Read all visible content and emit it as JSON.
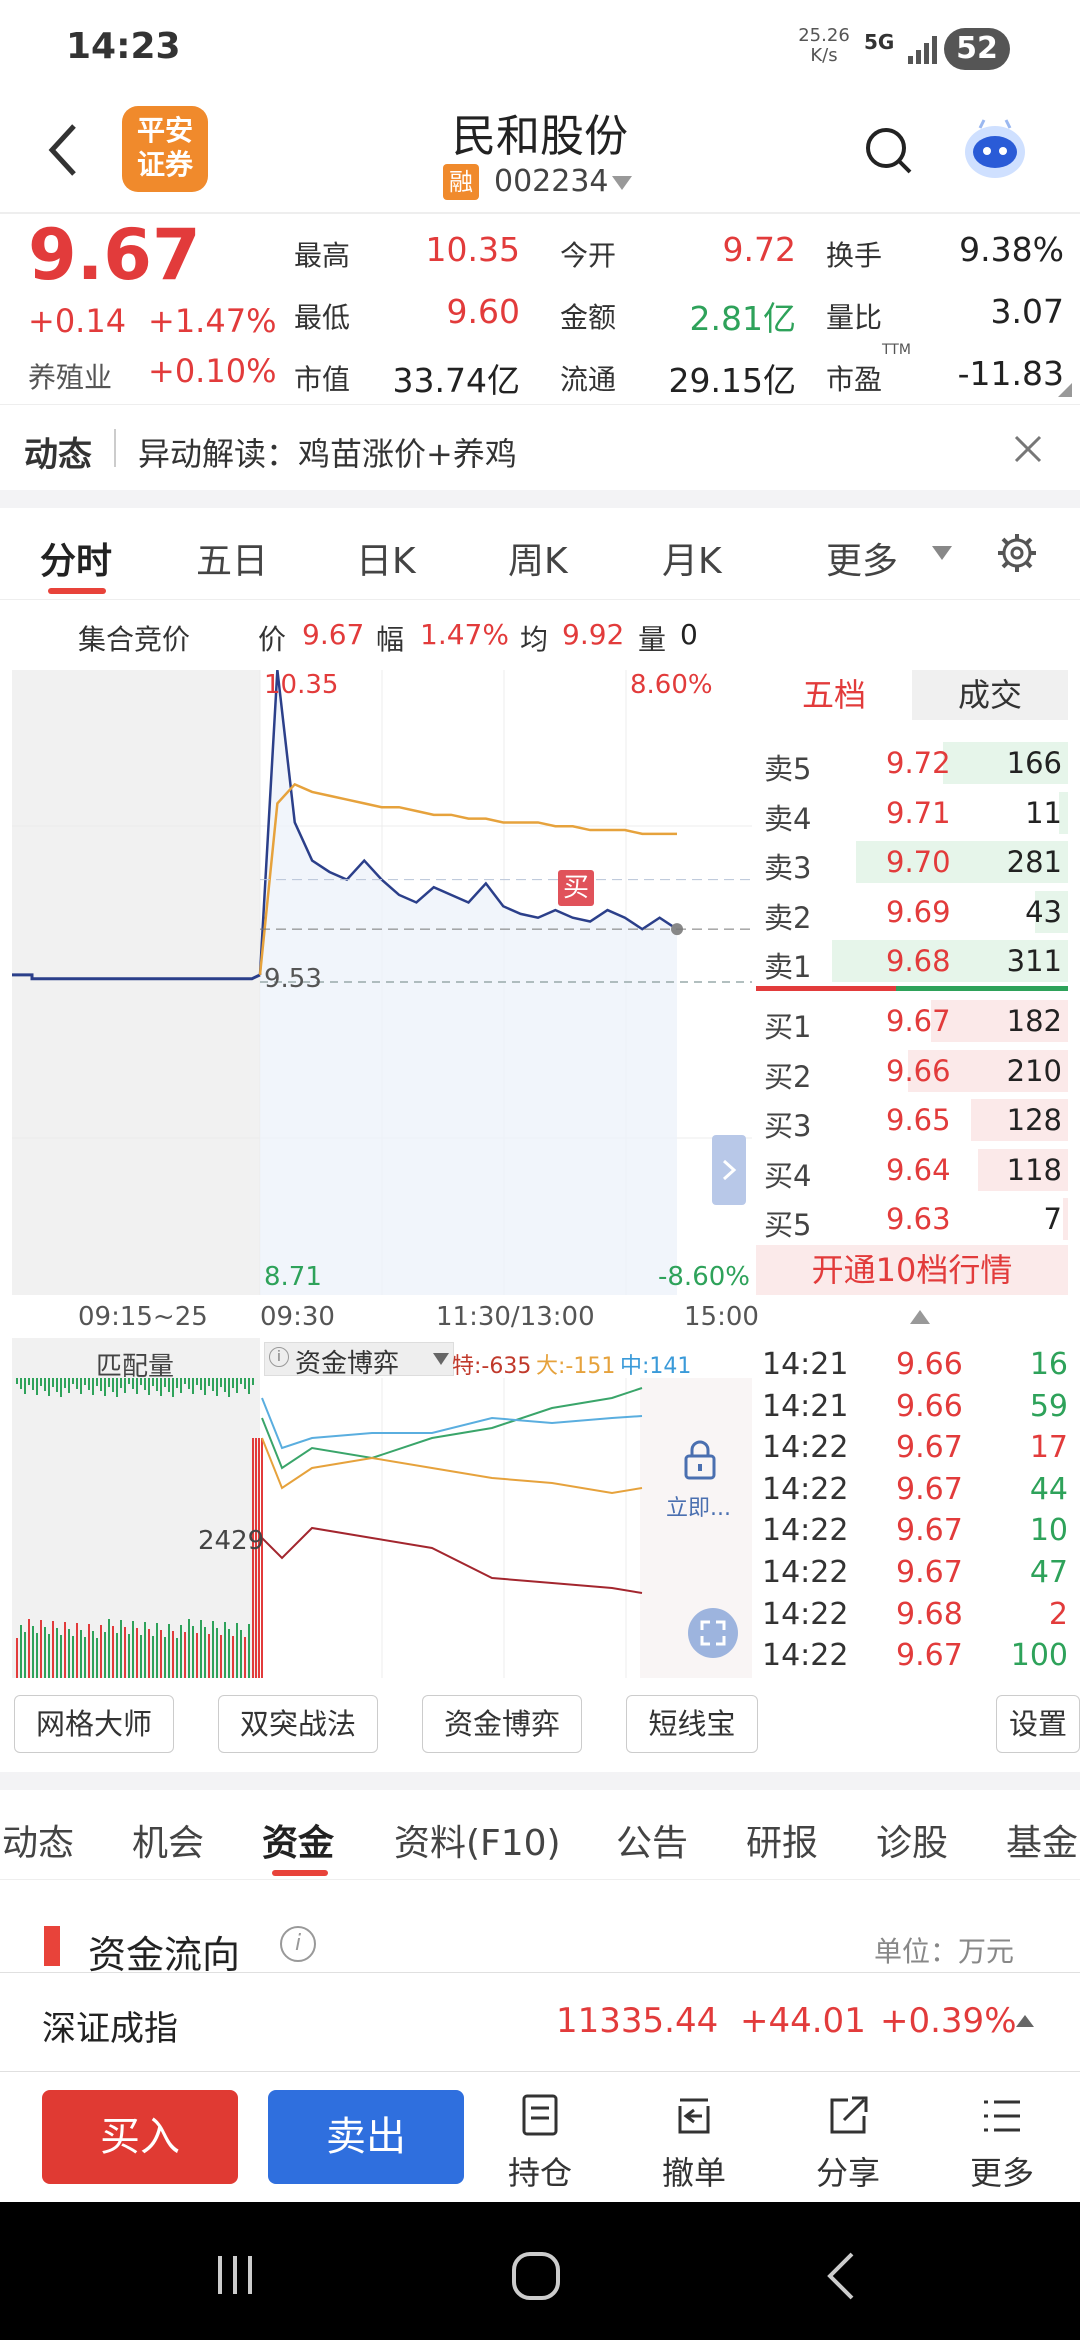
{
  "status": {
    "time": "14:23",
    "speed": "25.26",
    "speed_unit": "K/s",
    "network": "5G",
    "battery": "52"
  },
  "header": {
    "logo_line1": "平安",
    "logo_line2": "证券",
    "title": "民和股份",
    "badge": "融",
    "code": "002234"
  },
  "quote": {
    "price": "9.67",
    "change": "+0.14",
    "change_pct": "+1.47%",
    "industry": "养殖业",
    "industry_pct": "+0.10%",
    "stats": [
      {
        "label": "最高",
        "value": "10.35"
      },
      {
        "label": "今开",
        "value": "9.72"
      },
      {
        "label": "换手",
        "value": "9.38%"
      },
      {
        "label": "最低",
        "value": "9.60"
      },
      {
        "label": "金额",
        "value": "2.81亿"
      },
      {
        "label": "量比",
        "value": "3.07"
      },
      {
        "label": "市值",
        "value": "33.74亿"
      },
      {
        "label": "流通",
        "value": "29.15亿"
      },
      {
        "label": "市盈",
        "value": "-11.83"
      }
    ],
    "ttm": "TTM"
  },
  "news": {
    "label": "动态",
    "text": "异动解读：鸡苗涨价+养鸡"
  },
  "chart_tabs": [
    "分时",
    "五日",
    "日K",
    "周K",
    "月K",
    "更多"
  ],
  "chart_info": {
    "auction": "集合竞价",
    "price_label": "价",
    "price": "9.67",
    "amp_label": "幅",
    "amp": "1.47%",
    "avg_label": "均",
    "avg": "9.92",
    "vol_label": "量",
    "vol": "0"
  },
  "chart_data": {
    "type": "line",
    "y_high": "10.35",
    "y_low": "8.71",
    "y_mid": "9.53",
    "pct_high": "8.60%",
    "pct_low": "-8.60%",
    "x_ticks": [
      "09:15~25",
      "09:30",
      "11:30/13:00",
      "15:00"
    ],
    "ylim": [
      8.71,
      10.35
    ],
    "series": [
      {
        "name": "价",
        "color": "#2b3f8a",
        "values": [
          9.55,
          10.35,
          9.95,
          9.85,
          9.82,
          9.8,
          9.85,
          9.8,
          9.76,
          9.74,
          9.78,
          9.76,
          9.74,
          9.79,
          9.73,
          9.71,
          9.7,
          9.72,
          9.7,
          9.69,
          9.72,
          9.7,
          9.67,
          9.7,
          9.67
        ]
      },
      {
        "name": "均",
        "color": "#e6a23c",
        "values": [
          9.55,
          10.0,
          10.05,
          10.03,
          10.02,
          10.01,
          10.0,
          9.99,
          9.99,
          9.98,
          9.97,
          9.97,
          9.96,
          9.96,
          9.95,
          9.95,
          9.95,
          9.94,
          9.94,
          9.93,
          9.93,
          9.93,
          9.92,
          9.92,
          9.92
        ]
      }
    ],
    "buy_marker": "买"
  },
  "order_book": {
    "tab_active": "五档",
    "tab_other": "成交",
    "asks": [
      {
        "label": "卖5",
        "price": "9.72",
        "vol": "166",
        "ratio": 0.53
      },
      {
        "label": "卖4",
        "price": "9.71",
        "vol": "11",
        "ratio": 0.04
      },
      {
        "label": "卖3",
        "price": "9.70",
        "vol": "281",
        "ratio": 0.9
      },
      {
        "label": "卖2",
        "price": "9.69",
        "vol": "43",
        "ratio": 0.14
      },
      {
        "label": "卖1",
        "price": "9.68",
        "vol": "311",
        "ratio": 1.0
      }
    ],
    "bids": [
      {
        "label": "买1",
        "price": "9.67",
        "vol": "182",
        "ratio": 0.58
      },
      {
        "label": "买2",
        "price": "9.66",
        "vol": "210",
        "ratio": 0.68
      },
      {
        "label": "买3",
        "price": "9.65",
        "vol": "128",
        "ratio": 0.41
      },
      {
        "label": "买4",
        "price": "9.64",
        "vol": "118",
        "ratio": 0.38
      },
      {
        "label": "买5",
        "price": "9.63",
        "vol": "7",
        "ratio": 0.02
      }
    ],
    "upgrade": "开通10档行情"
  },
  "flow": {
    "match_label": "匹配量",
    "mode": "资金博弈",
    "special": "特:-635",
    "large": "大:-151",
    "mid": "中:141",
    "vol_value": "2429",
    "lock_text": "立即..."
  },
  "ticks": [
    {
      "time": "14:21",
      "price": "9.66",
      "vol": "16",
      "dir": "green"
    },
    {
      "time": "14:21",
      "price": "9.66",
      "vol": "59",
      "dir": "green"
    },
    {
      "time": "14:22",
      "price": "9.67",
      "vol": "17",
      "dir": "red"
    },
    {
      "time": "14:22",
      "price": "9.67",
      "vol": "44",
      "dir": "green"
    },
    {
      "time": "14:22",
      "price": "9.67",
      "vol": "10",
      "dir": "green"
    },
    {
      "time": "14:22",
      "price": "9.67",
      "vol": "47",
      "dir": "green"
    },
    {
      "time": "14:22",
      "price": "9.68",
      "vol": "2",
      "dir": "red"
    },
    {
      "time": "14:22",
      "price": "9.67",
      "vol": "100",
      "dir": "green"
    }
  ],
  "tools": [
    "网格大师",
    "双突战法",
    "资金博弈",
    "短线宝",
    "设置"
  ],
  "sub_tabs": [
    "动态",
    "机会",
    "资金",
    "资料(F10)",
    "公告",
    "研报",
    "诊股",
    "基金"
  ],
  "flow_section": {
    "title": "资金流向",
    "unit": "单位：万元"
  },
  "index_bar": {
    "name": "深证成指",
    "value": "11335.44",
    "change": "+44.01",
    "pct": "+0.39%"
  },
  "actions": {
    "buy": "买入",
    "sell": "卖出",
    "hold": "持仓",
    "cancel": "撤单",
    "share": "分享",
    "more": "更多"
  },
  "colors": {
    "up": "#e23b3b",
    "down": "#2ea25a",
    "accent": "#e8433a",
    "blue": "#2f6fde",
    "logo": "#f08a2c"
  }
}
